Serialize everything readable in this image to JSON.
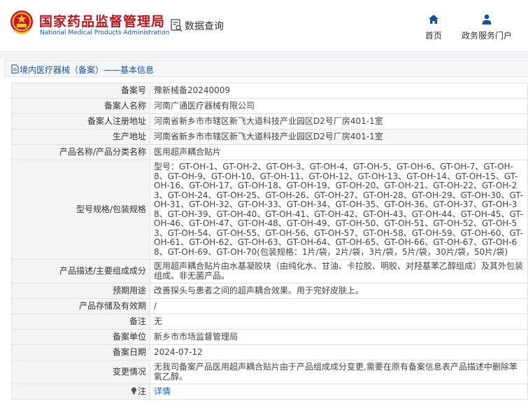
{
  "header": {
    "org_name_cn": "国家药品监督管理局",
    "org_name_en": "National Medical Products Administration",
    "query_label": "数据查询",
    "nav": {
      "home": "首页",
      "gov_portal": "政务服务门户"
    }
  },
  "breadcrumb": {
    "text": "境内医疗器械（备案）——基本信息"
  },
  "record": {
    "filing_no": {
      "label": "备案号",
      "value": "豫新械备20240009"
    },
    "filer": {
      "label": "备案人名称",
      "value": "河南广通医疗器械有限公司"
    },
    "reg_address": {
      "label": "备案人注册地址",
      "value": "河南省新乡市市辖区新飞大道科技产业园区D2号厂房401-1室"
    },
    "prod_address": {
      "label": "生产地址",
      "value": "河南省新乡市市辖区新飞大道科技产业园区D2号厂房401-1室"
    },
    "product_name": {
      "label": "产品名称/产品分类名称",
      "value": "医用超声耦合贴片"
    },
    "model_spec": {
      "label": "型号规格/包装规格",
      "value": "型号：GT-OH-1、GT-OH-2、GT-OH-3、GT-OH-4、GT-OH-5、GT-OH-6、GT-OH-7、GT-OH-8、GT-OH-9、GT-OH-10、GT-OH-11、GT-OH-12、GT-OH-13、GT-OH-14、GT-OH-15、GT-OH-16、GT-OH-17、GT-OH-18、GT-OH-19、GT-OH-20、GT-OH-21、GT-OH-22、GT-OH-23、GT-OH-24、GT-OH-25、GT-OH-26、GT-OH-27、GT-OH-28、GT-OH-29、GT-OH-30、GT-OH-31、GT-OH-32、GT-OH-33、GT-OH-34、GT-OH-35、GT-OH-36、GT-OH-37、GT-OH-38、GT-OH-39、GT-OH-40、GT-OH-41、GT-OH-42、GT-OH-43、GT-OH-44、GT-OH-45、GT-OH-46、GT-OH-47、GT-OH-48、GT-OH-49、GT-OH-50、GT-OH-51、GT-OH-52、GT-OH-53、GT-OH-54、GT-OH-55、GT-OH-56、GT-OH-57、GT-OH-58、GT-OH-59、GT-OH-60、GT-OH-61、GT-OH-62、GT-OH-63、GT-OH-64、GT-OH-65、GT-OH-66、GT-OH-67、GT-OH-68、GT-OH-69、GT-OH-70(包装规格：1片/袋，2片/袋，3片/袋，5片/袋，30片/袋，50片/袋)"
    },
    "description": {
      "label": "产品描述/主要组成成分",
      "value": "医用超声耦合贴片由水基凝胶块（由纯化水、甘油、卡拉胶、明胶、对羟基苯乙醇组成）及其外包装组成。非无菌产品。"
    },
    "intended_use": {
      "label": "预期用途",
      "value": "改善探头与患者之间的超声耦合效果。用于完好皮肤上。"
    },
    "storage": {
      "label": "产品存储及有效期",
      "value": "/"
    },
    "remark": {
      "label": "备注",
      "value": "无"
    },
    "filing_unit": {
      "label": "备案单位",
      "value": "新乡市市场监督管理局"
    },
    "filing_date": {
      "label": "备案日期",
      "value": "2024-07-12"
    },
    "change": {
      "label": "变更情况",
      "value": "无我司备案产品医用超声耦合贴片由于产品组成成分变更,需要在原有备案信息表产品描述中删除苯氧乙醇。"
    },
    "note": {
      "label": "注",
      "value": "详情"
    }
  },
  "colors": {
    "brand_red": "#b8161c",
    "brand_blue": "#1e4f9c",
    "link": "#1c5cc6"
  }
}
